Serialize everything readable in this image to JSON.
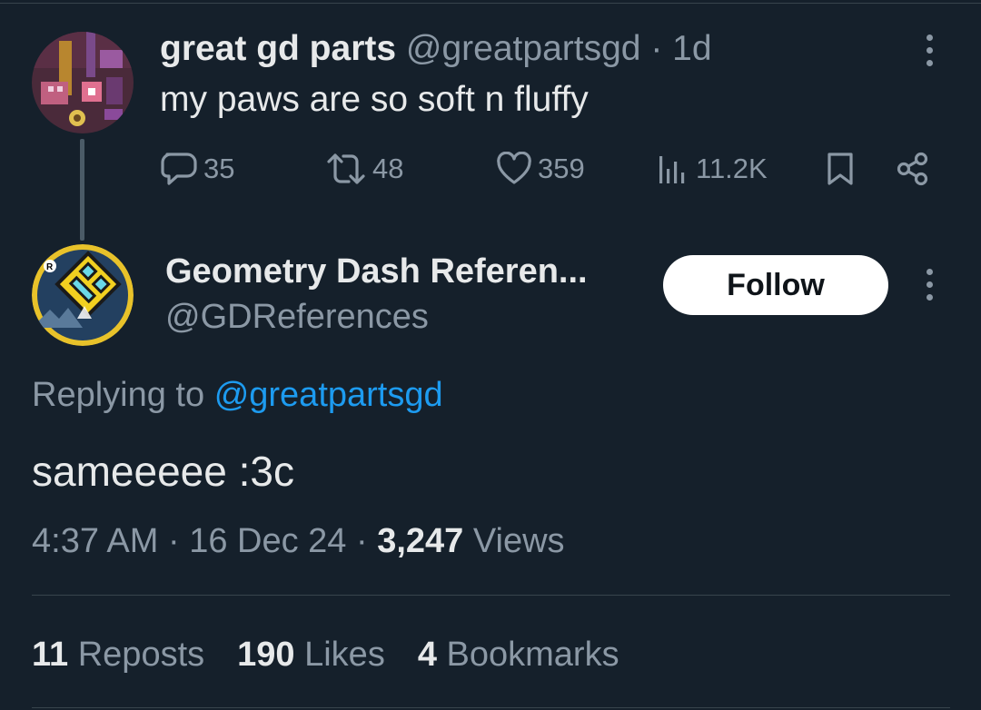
{
  "parent_tweet": {
    "display_name": "great gd parts",
    "handle": "@greatpartsgd",
    "separator": "·",
    "time": "1d",
    "text": "my paws are so soft n fluffy",
    "actions": {
      "replies": "35",
      "reposts": "48",
      "likes": "359",
      "views": "11.2K"
    }
  },
  "reply_tweet": {
    "display_name": "Geometry Dash Referen...",
    "handle": "@GDReferences",
    "follow_label": "Follow",
    "replying_prefix": "Replying to",
    "replying_mention": "@greatpartsgd",
    "text": "sameeeee :3c",
    "time": "4:37 AM",
    "separator": "·",
    "date": "16 Dec 24",
    "views_count": "3,247",
    "views_label": "Views"
  },
  "stats": {
    "reposts_count": "11",
    "reposts_label": "Reposts",
    "likes_count": "190",
    "likes_label": "Likes",
    "bookmarks_count": "4",
    "bookmarks_label": "Bookmarks"
  },
  "colors": {
    "background": "#15202b",
    "primary_text": "#e7e9ea",
    "secondary_text": "#8b98a5",
    "link": "#1d9bf0",
    "divider": "#38444d"
  },
  "icons": {
    "reply": "speech-bubble-icon",
    "repost": "repost-arrows-icon",
    "like": "heart-icon",
    "views": "bar-chart-icon",
    "bookmark": "bookmark-icon",
    "share": "share-nodes-icon",
    "more": "vertical-ellipsis-icon"
  }
}
